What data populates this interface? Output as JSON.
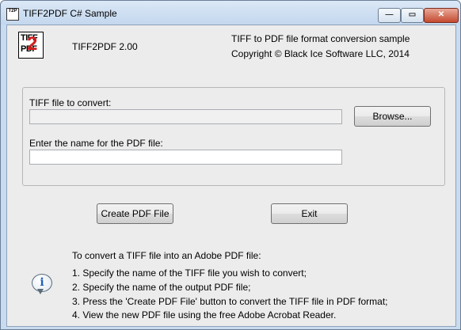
{
  "window": {
    "title": "TIFF2PDF C# Sample",
    "minimize_glyph": "—",
    "maximize_glyph": "▭",
    "close_glyph": "✕"
  },
  "logo": {
    "line1": "TIFF",
    "line2": "PDF",
    "digit": "2"
  },
  "header": {
    "version": "TIFF2PDF 2.00",
    "description": "TIFF to PDF file format conversion sample",
    "copyright": "Copyright © Black Ice Software LLC, 2014"
  },
  "form": {
    "tiff_label": "TIFF file to convert:",
    "tiff_value": "",
    "browse_label": "Browse...",
    "pdf_label": "Enter the name for the PDF file:",
    "pdf_value": ""
  },
  "actions": {
    "create_label": "Create PDF File",
    "exit_label": "Exit"
  },
  "instructions": {
    "title": "To convert a TIFF file into an Adobe PDF file:",
    "steps": [
      "1. Specify the name of the TIFF file you wish to convert;",
      "2. Specify the name of the output PDF file;",
      "3. Press the 'Create PDF File' button to convert the TIFF file in PDF format;",
      "4. View the new PDF file using the free Adobe Acrobat Reader."
    ]
  },
  "colors": {
    "accent_red": "#d21d1d",
    "info_blue": "#1f5fbf",
    "close_red": "#c44a2f"
  }
}
